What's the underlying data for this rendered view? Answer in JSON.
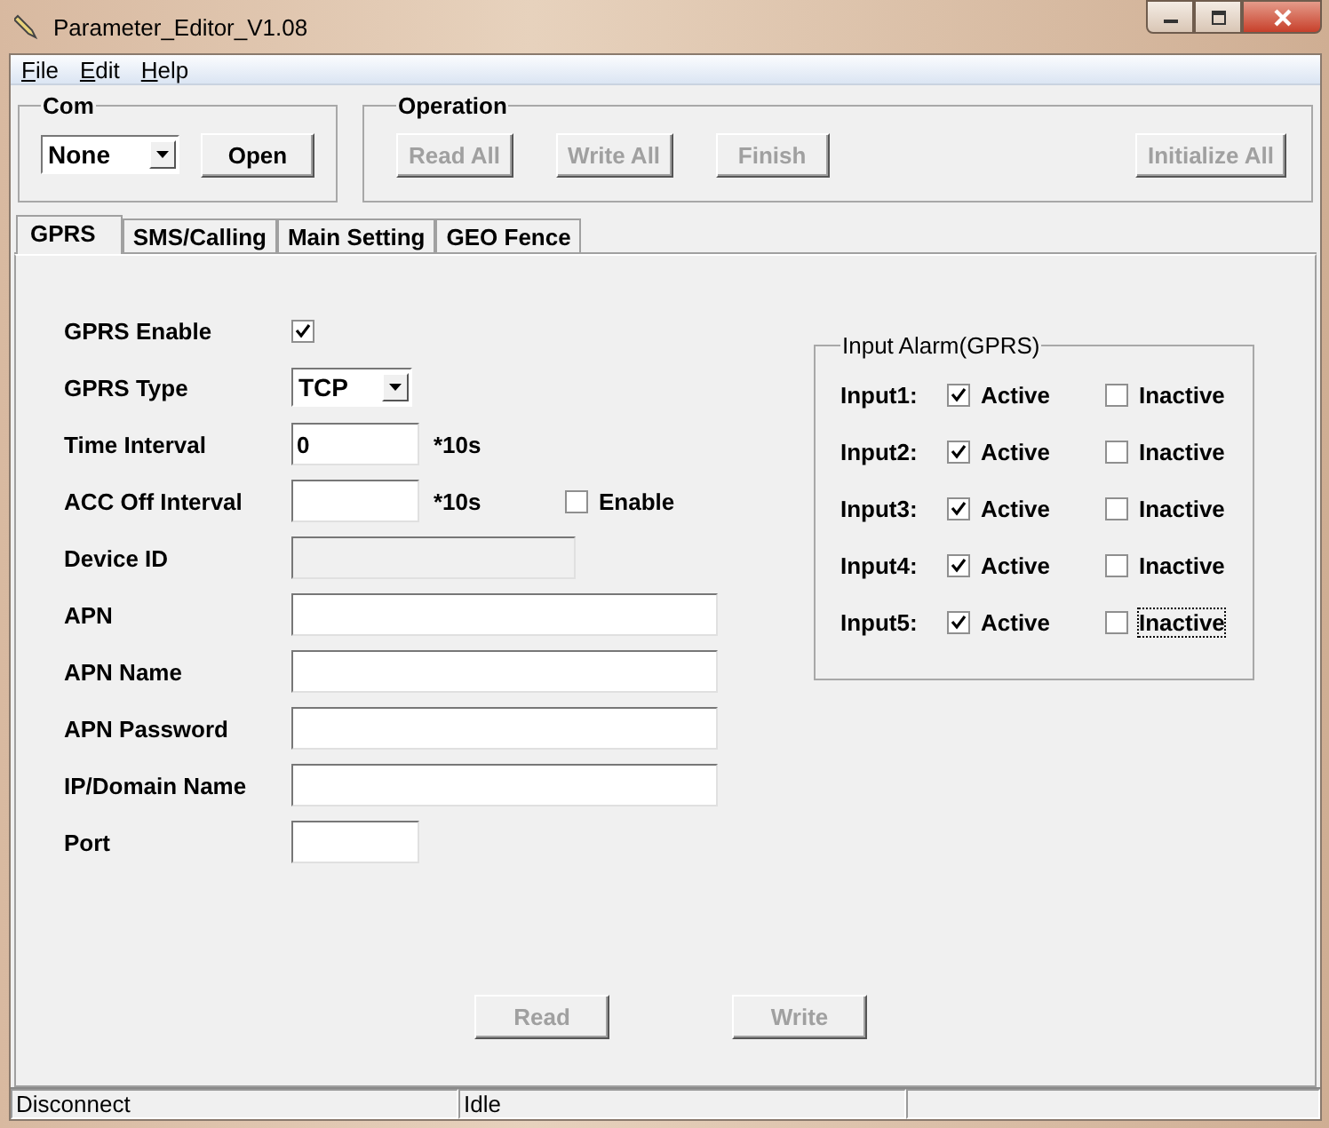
{
  "window": {
    "title": "Parameter_Editor_V1.08"
  },
  "menu": [
    "File",
    "Edit",
    "Help"
  ],
  "com": {
    "title": "Com",
    "port": "None",
    "button": {
      "label": "Open",
      "disabled": false
    }
  },
  "operation": {
    "title": "Operation",
    "buttons": [
      {
        "label": "Read All",
        "disabled": true
      },
      {
        "label": "Write All",
        "disabled": true
      },
      {
        "label": "Finish",
        "disabled": true
      },
      {
        "label": "Initialize All",
        "disabled": true
      }
    ]
  },
  "tabs": [
    {
      "label": "GPRS",
      "selected": true
    },
    {
      "label": "SMS/Calling",
      "selected": false
    },
    {
      "label": "Main Setting",
      "selected": false
    },
    {
      "label": "GEO  Fence",
      "selected": false
    }
  ],
  "fields": [
    {
      "label": "GPRS Enable",
      "kind": "checkbox",
      "checked": true
    },
    {
      "label": "GPRS Type",
      "kind": "select",
      "value": "TCP"
    },
    {
      "label": "Time Interval",
      "kind": "short",
      "value": "0",
      "unit": "*10s"
    },
    {
      "label": "ACC Off Interval",
      "kind": "short",
      "unit": "*10s",
      "option": {
        "label": "Enable",
        "checked": false
      }
    },
    {
      "label": "Device ID",
      "kind": "medium",
      "disabled": true
    },
    {
      "label": "APN",
      "kind": "wide",
      "disabled": false
    },
    {
      "label": "APN Name",
      "kind": "wide",
      "disabled": false
    },
    {
      "label": "APN Password",
      "kind": "wide",
      "disabled": false
    },
    {
      "label": "IP/Domain Name",
      "kind": "wide",
      "disabled": false
    },
    {
      "label": "Port",
      "kind": "short"
    }
  ],
  "input_alarm": {
    "title": "Input Alarm(GPRS)",
    "rows": [
      {
        "label": "Input1:",
        "active": {
          "label": "Active",
          "checked": true
        },
        "inactive": {
          "label": "Inactive",
          "checked": false,
          "focused": false
        }
      },
      {
        "label": "Input2:",
        "active": {
          "label": "Active",
          "checked": true
        },
        "inactive": {
          "label": "Inactive",
          "checked": false,
          "focused": false
        }
      },
      {
        "label": "Input3:",
        "active": {
          "label": "Active",
          "checked": true
        },
        "inactive": {
          "label": "Inactive",
          "checked": false,
          "focused": false
        }
      },
      {
        "label": "Input4:",
        "active": {
          "label": "Active",
          "checked": true
        },
        "inactive": {
          "label": "Inactive",
          "checked": false,
          "focused": false
        }
      },
      {
        "label": "Input5:",
        "active": {
          "label": "Active",
          "checked": true
        },
        "inactive": {
          "label": "Inactive",
          "checked": false,
          "focused": true
        }
      }
    ]
  },
  "actions": [
    {
      "label": "Read",
      "disabled": true
    },
    {
      "label": "Write",
      "disabled": true
    }
  ],
  "status_bar": [
    "Disconnect",
    "Idle"
  ]
}
